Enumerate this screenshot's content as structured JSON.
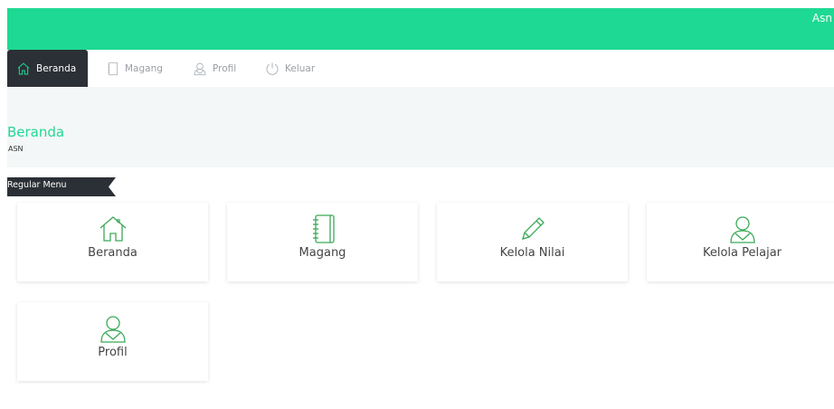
{
  "topbar": {
    "user": "Asn"
  },
  "nav": {
    "items": [
      {
        "label": "Beranda",
        "icon": "home-icon",
        "active": true
      },
      {
        "label": "Magang",
        "icon": "notebook-icon",
        "active": false
      },
      {
        "label": "Profil",
        "icon": "user-icon",
        "active": false
      },
      {
        "label": "Keluar",
        "icon": "power-icon",
        "active": false
      }
    ]
  },
  "header": {
    "title": "Beranda",
    "subtitle": "ASN"
  },
  "section": {
    "label": "Regular Menu"
  },
  "cards": [
    {
      "label": "Beranda",
      "icon": "home-icon"
    },
    {
      "label": "Magang",
      "icon": "notebook-icon"
    },
    {
      "label": "Kelola Nilai",
      "icon": "pencil-icon"
    },
    {
      "label": "Kelola Pelajar",
      "icon": "user-icon"
    },
    {
      "label": "Profil",
      "icon": "user-icon"
    }
  ],
  "colors": {
    "accent": "#1ed993",
    "dark": "#2b3036",
    "icon": "#3aa957",
    "band": "#f4f7f8"
  }
}
